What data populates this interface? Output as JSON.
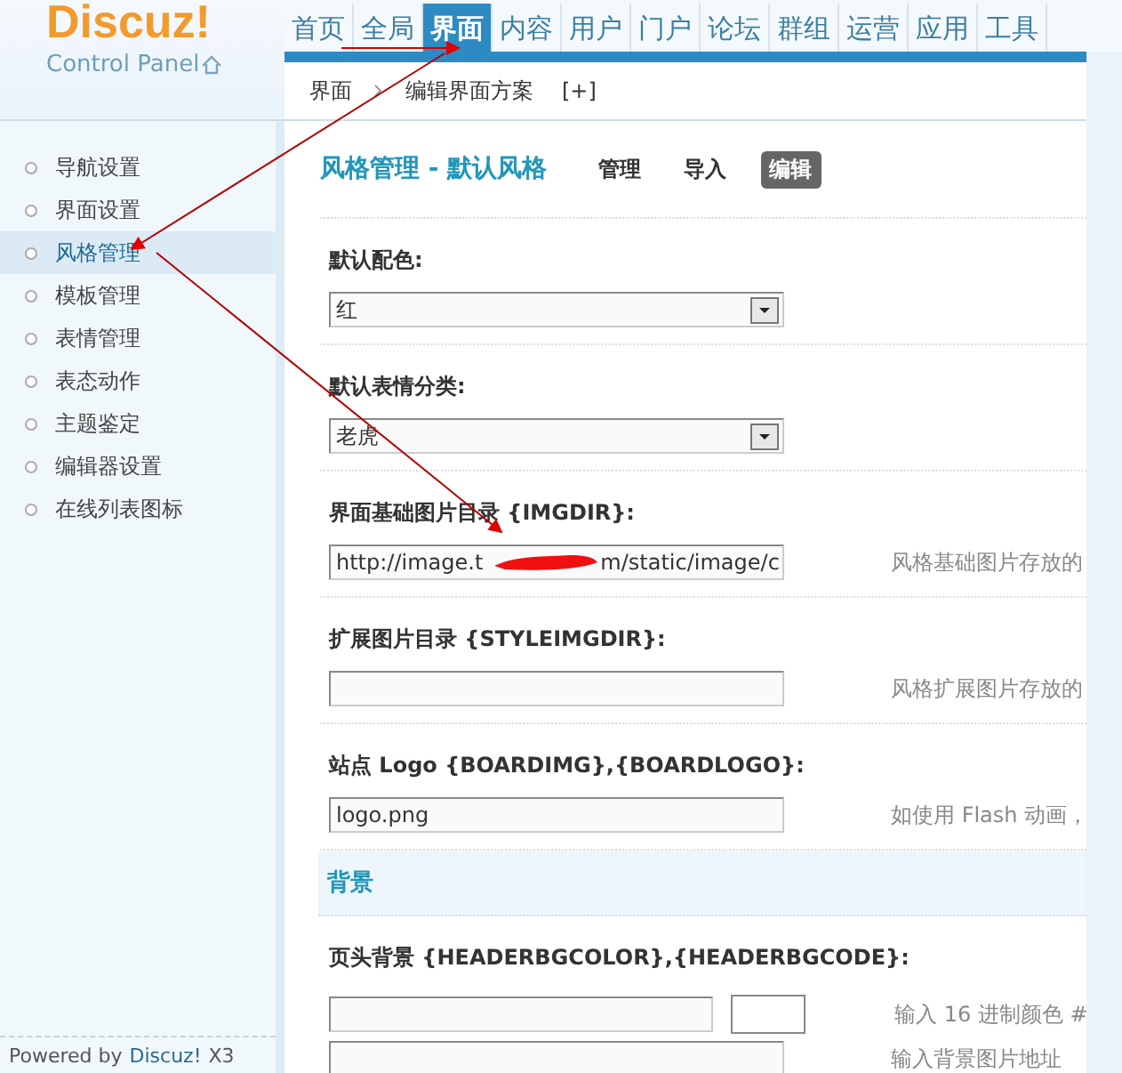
{
  "logo": {
    "name": "Discuz!",
    "subtitle": "Control Panel"
  },
  "nav_tabs": [
    {
      "label": "首页",
      "selected": false
    },
    {
      "label": "全局",
      "selected": false
    },
    {
      "label": "界面",
      "selected": true
    },
    {
      "label": "内容",
      "selected": false
    },
    {
      "label": "用户",
      "selected": false
    },
    {
      "label": "门户",
      "selected": false
    },
    {
      "label": "论坛",
      "selected": false
    },
    {
      "label": "群组",
      "selected": false
    },
    {
      "label": "运营",
      "selected": false
    },
    {
      "label": "应用",
      "selected": false
    },
    {
      "label": "工具",
      "selected": false
    }
  ],
  "breadcrumb": {
    "items": [
      "界面",
      "编辑界面方案"
    ],
    "action": "[+]"
  },
  "sidebar": {
    "items": [
      {
        "label": "导航设置",
        "selected": false
      },
      {
        "label": "界面设置",
        "selected": false
      },
      {
        "label": "风格管理",
        "selected": true
      },
      {
        "label": "模板管理",
        "selected": false
      },
      {
        "label": "表情管理",
        "selected": false
      },
      {
        "label": "表态动作",
        "selected": false
      },
      {
        "label": "主题鉴定",
        "selected": false
      },
      {
        "label": "编辑器设置",
        "selected": false
      },
      {
        "label": "在线列表图标",
        "selected": false
      }
    ],
    "footer": {
      "prefix": "Powered by",
      "brand": "Discuz!",
      "version": "X3"
    }
  },
  "page": {
    "title": "风格管理 - 默认风格",
    "tabs": [
      {
        "label": "管理",
        "selected": false
      },
      {
        "label": "导入",
        "selected": false
      },
      {
        "label": "编辑",
        "selected": true
      }
    ]
  },
  "form": [
    {
      "kind": "select",
      "label": "默认配色:",
      "value": "红"
    },
    {
      "kind": "select",
      "label": "默认表情分类:",
      "value": "老虎"
    },
    {
      "kind": "text",
      "label": "界面基础图片目录 {IMGDIR}:",
      "value_before": "http://image.t",
      "value_after": "m/static/image/c",
      "redacted": true,
      "hint": "风格基础图片存放的"
    },
    {
      "kind": "text",
      "label": "扩展图片目录 {STYLEIMGDIR}:",
      "hint": "风格扩展图片存放的"
    },
    {
      "kind": "text",
      "label": "站点 Logo {BOARDIMG},{BOARDLOGO}:",
      "value_before": "logo.png",
      "hint": "如使用 Flash 动画，"
    },
    {
      "kind": "section",
      "label": "背景"
    },
    {
      "kind": "color",
      "label": "页头背景 {HEADERBGCOLOR},{HEADERBGCODE}:",
      "hint": "输入 16 进制颜色 #",
      "hint2": "输入背景图片地址"
    }
  ]
}
